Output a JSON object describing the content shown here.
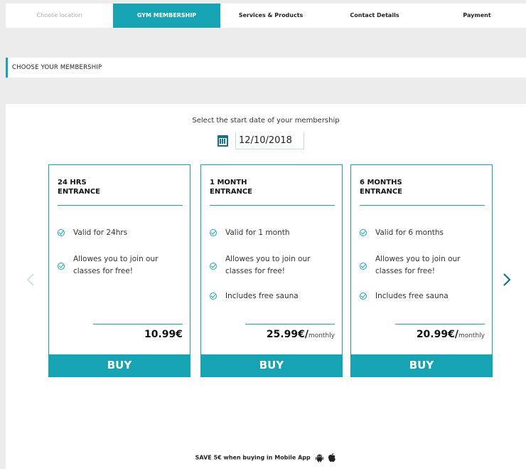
{
  "steps": [
    {
      "label": "Choose location",
      "state": "done"
    },
    {
      "label": "GYM MEMBERSHIP",
      "state": "active"
    },
    {
      "label": "Services & Products",
      "state": "pending"
    },
    {
      "label": "Contact Details",
      "state": "pending"
    },
    {
      "label": "Payment",
      "state": "pending"
    }
  ],
  "section": {
    "title": "CHOOSE YOUR MEMBERSHIP"
  },
  "date": {
    "label": "Select the start date of your membership",
    "value": "12/10/2018",
    "icon": "calendar-icon"
  },
  "cards": [
    {
      "title_line1": "24 HRS",
      "title_line2": "ENTRANCE",
      "features": [
        "Valid for 24hrs",
        "Allowes you to join our classes for free!"
      ],
      "price": "10.99€",
      "period": "",
      "buy_label": "BUY"
    },
    {
      "title_line1": "1 MONTH",
      "title_line2": "ENTRANCE",
      "features": [
        "Valid for 1 month",
        "Allowes you to join our classes for free!",
        "Includes free sauna"
      ],
      "price": "25.99€/",
      "period": "monthly",
      "buy_label": "BUY"
    },
    {
      "title_line1": "6 MONTHS",
      "title_line2": "ENTRANCE",
      "features": [
        "Valid for 6 months",
        "Allowes you to join our classes for free!",
        "Includes free sauna"
      ],
      "price": "20.99€/",
      "period": "monthly",
      "buy_label": "BUY"
    }
  ],
  "carousel": {
    "prev_icon": "chevron-left-icon",
    "next_icon": "chevron-right-icon"
  },
  "promo": {
    "text": "SAVE 5€ when buying in Mobile App",
    "icons": [
      "android-icon",
      "apple-icon"
    ]
  },
  "colors": {
    "accent": "#16a3b3",
    "background": "#ececec",
    "disabled_arrow": "#cfe3e6"
  }
}
